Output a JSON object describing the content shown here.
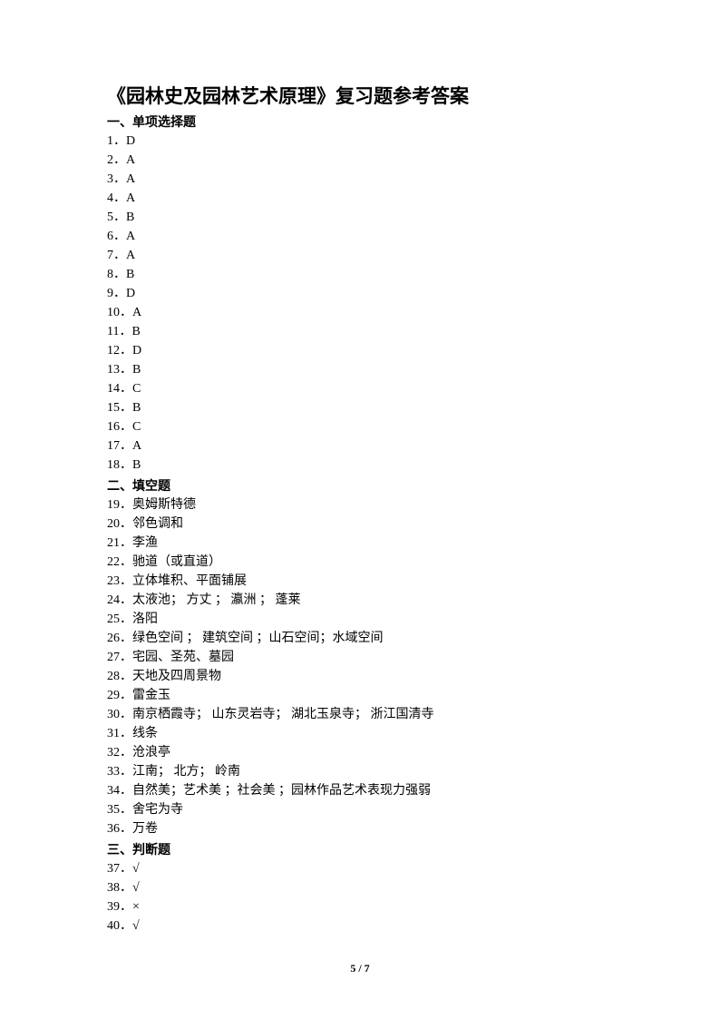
{
  "title": "《园林史及园林艺术原理》复习题参考答案",
  "sections": {
    "mc_header": "一、单项选择题",
    "fill_header": "二、填空题",
    "judge_header": "三、判断题"
  },
  "mc": [
    "1．D",
    "2．A",
    "3．A",
    "4．A",
    "5．B",
    "6．A",
    "7．A",
    "8．B",
    "9．D",
    "10．A",
    "11．B",
    "12．D",
    "13．B",
    "14．C",
    "15．B",
    "16．C",
    "17．A",
    "18．B"
  ],
  "fill": [
    "19．奥姆斯特德",
    "20．邻色调和",
    "21．李渔",
    "22．驰道（或直道）",
    "23．立体堆积、平面铺展",
    "24．太液池；   方丈  ；  瀛洲  ；  蓬莱",
    "25．洛阳",
    "26．绿色空间  ；  建筑空间  ；山石空间；水域空间",
    "27．宅园、圣苑、墓园",
    "28．天地及四周景物",
    "29．雷金玉",
    "30．南京栖霞寺；  山东灵岩寺；   湖北玉泉寺；   浙江国清寺",
    "31．线条",
    "32．沧浪亭",
    "33．江南；  北方；  岭南",
    "34．自然美；艺术美  ；社会美  ；园林作品艺术表现力强弱",
    "35．舍宅为寺",
    "36．万卷"
  ],
  "judge": [
    "37．√",
    "38．√",
    "39．×",
    "40．√"
  ],
  "footer": "5 / 7"
}
